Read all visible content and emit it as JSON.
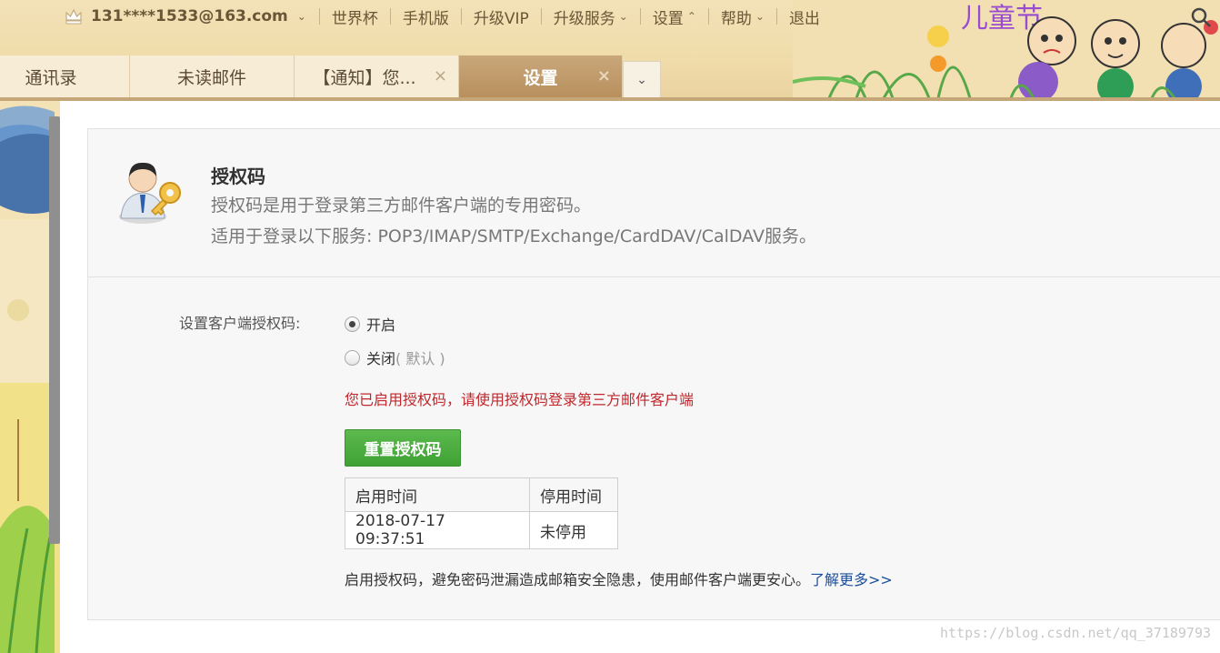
{
  "header": {
    "account": "131****1533@163.com",
    "nav": [
      {
        "label": "世界杯",
        "chevron": false
      },
      {
        "label": "手机版",
        "chevron": false
      },
      {
        "label": "升级VIP",
        "chevron": false
      },
      {
        "label": "升级服务",
        "chevron": true
      },
      {
        "label": "设置",
        "chevron": "up"
      },
      {
        "label": "帮助",
        "chevron": true
      },
      {
        "label": "退出",
        "chevron": false
      }
    ]
  },
  "tabs": [
    {
      "label": "通讯录",
      "active": false,
      "closable": false
    },
    {
      "label": "未读邮件",
      "active": false,
      "closable": false
    },
    {
      "label": "【通知】您...",
      "active": false,
      "closable": true
    },
    {
      "label": "设置",
      "active": true,
      "closable": true
    }
  ],
  "panel": {
    "title": "授权码",
    "desc1": "授权码是用于登录第三方邮件客户端的专用密码。",
    "desc2": "适用于登录以下服务: POP3/IMAP/SMTP/Exchange/CardDAV/CalDAV服务。",
    "setting_label": "设置客户端授权码:",
    "option_on": "开启",
    "option_off": "关闭",
    "option_off_note": "( 默认 )",
    "selected": "开启",
    "notice": "您已启用授权码，请使用授权码登录第三方邮件客户端",
    "reset_button": "重置授权码",
    "table": {
      "headers": [
        "启用时间",
        "停用时间"
      ],
      "rows": [
        [
          "2018-07-17 09:37:51",
          "未停用"
        ]
      ]
    },
    "footer_text": "启用授权码，避免密码泄漏造成邮箱安全隐患，使用邮件客户端更安心。",
    "footer_link": "了解更多>>"
  },
  "watermark": "https://blog.csdn.net/qq_37189793",
  "colors": {
    "accent_tab": "#b88f5d",
    "reset_button": "#4caf3f",
    "notice_red": "#c0272d",
    "link_blue": "#1b4e9c"
  }
}
